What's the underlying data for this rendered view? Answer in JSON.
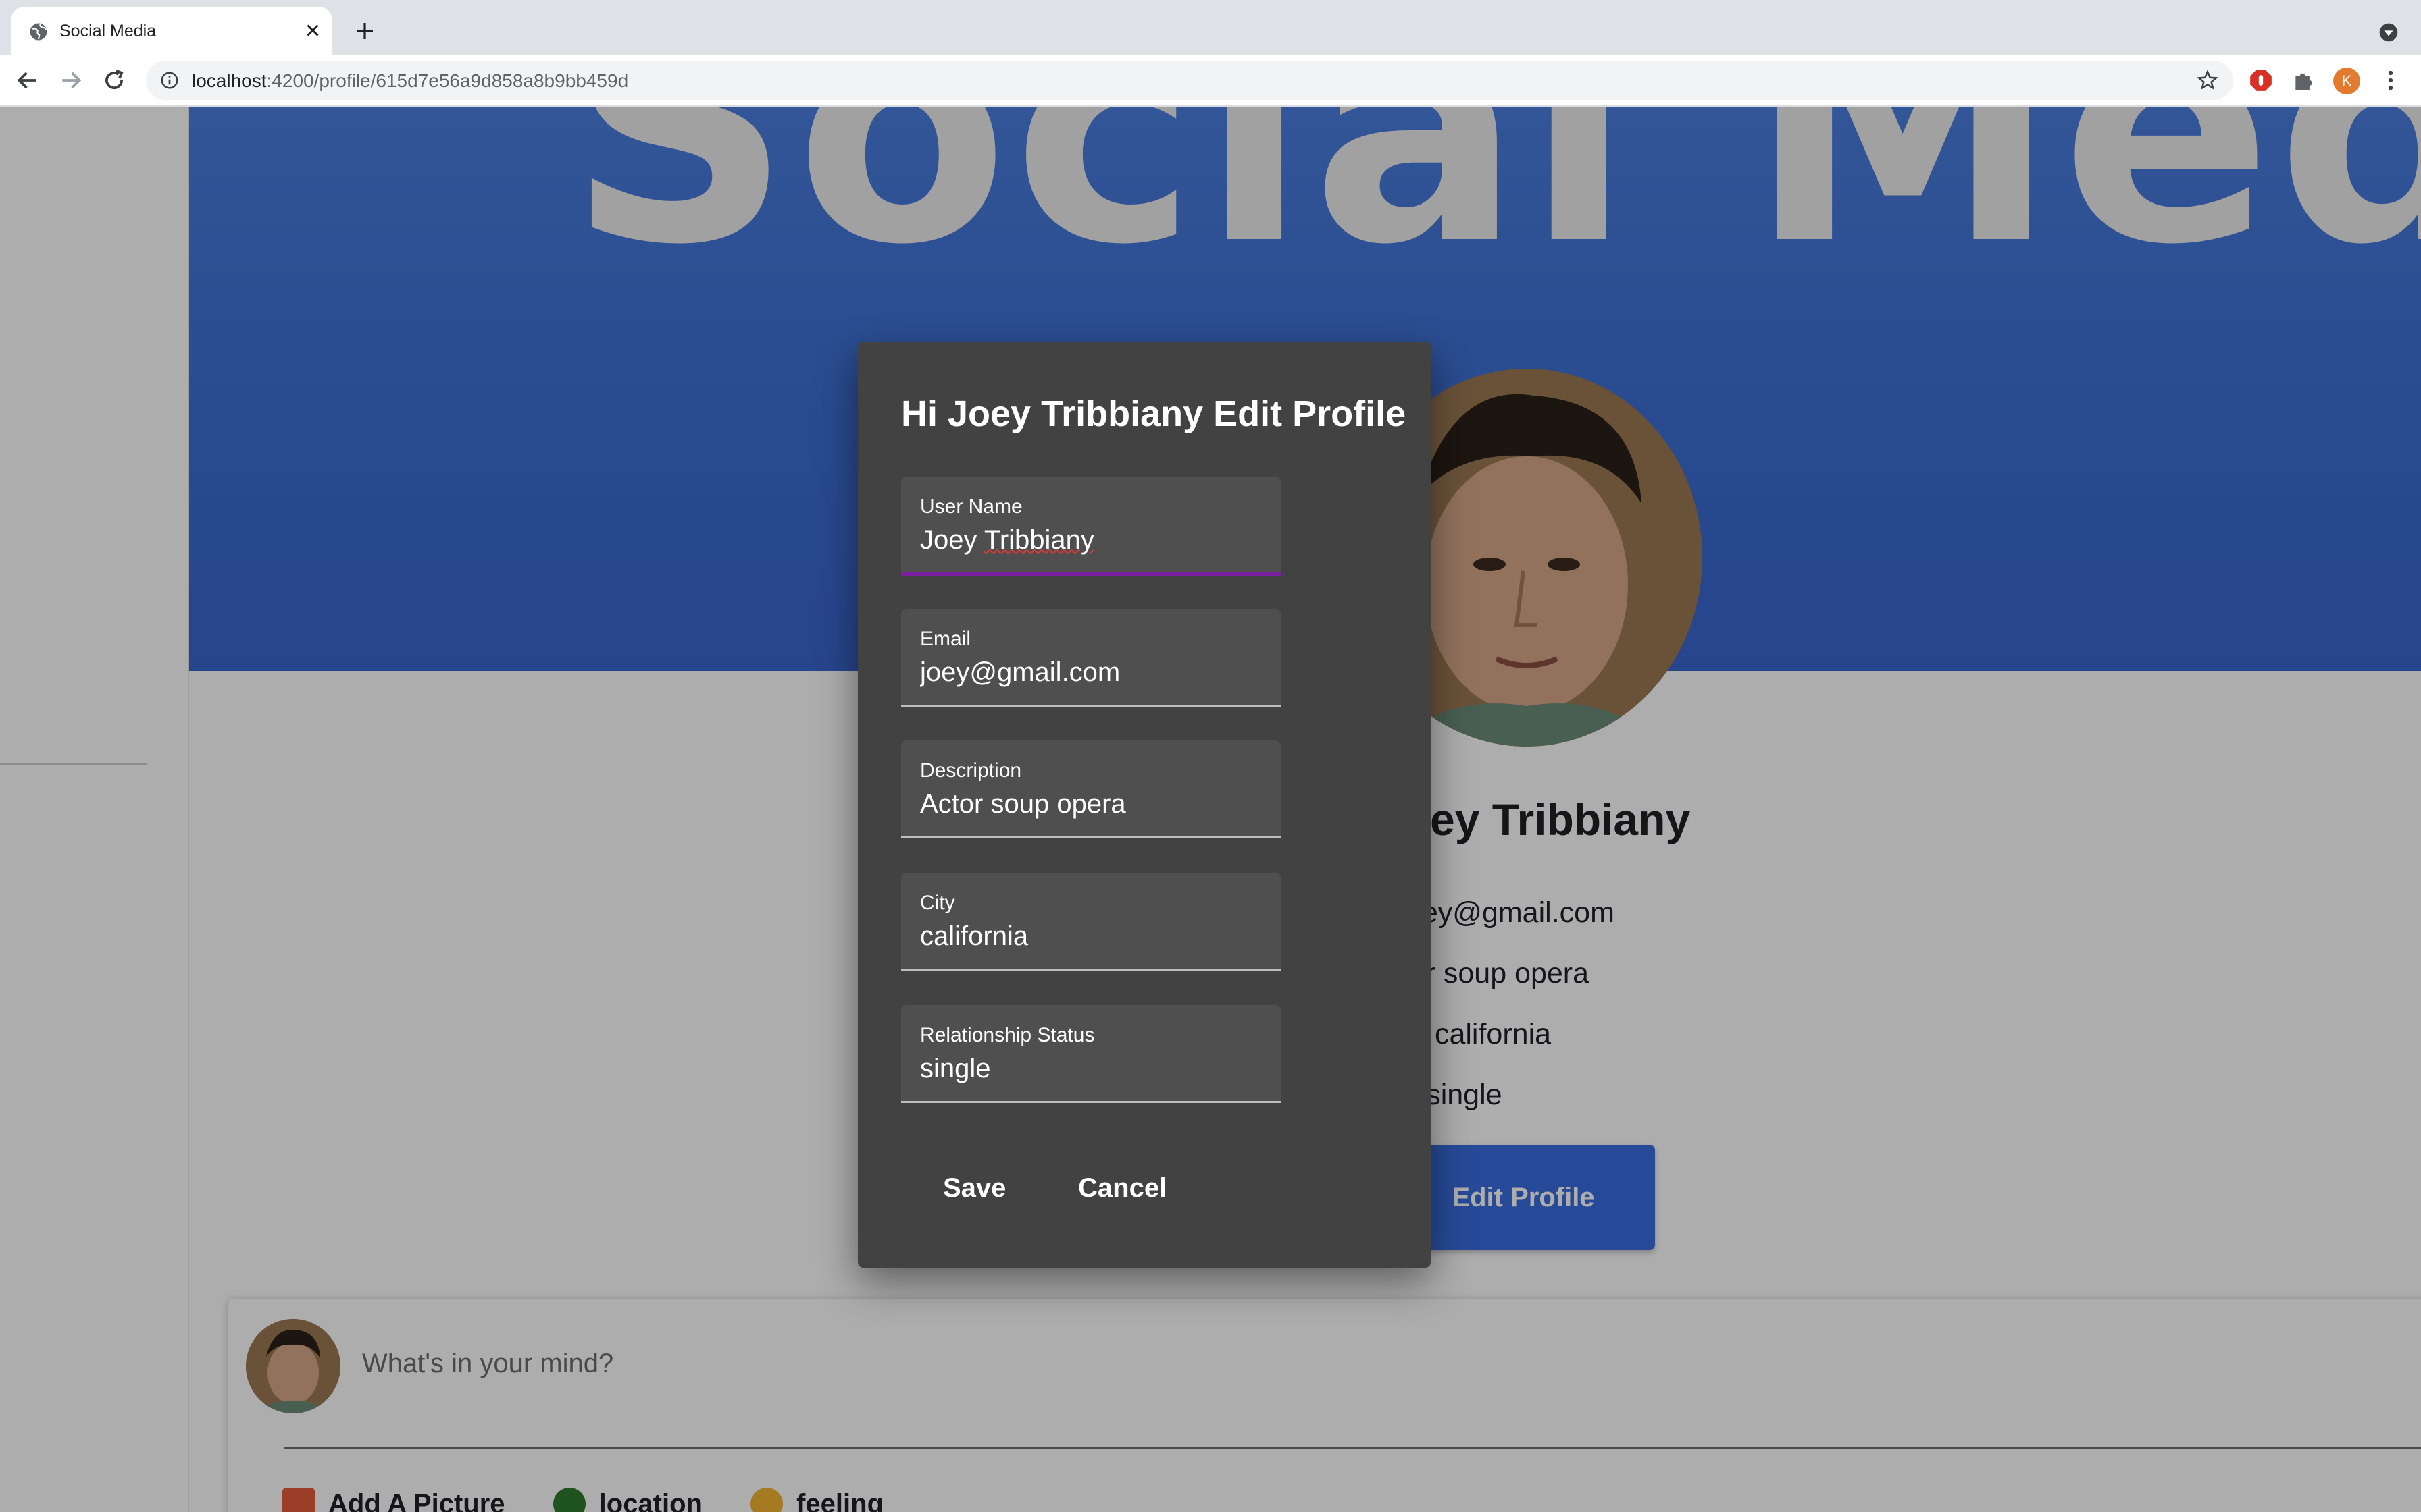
{
  "browser": {
    "tab_title": "Social Media",
    "url_host": "localhost",
    "url_path": ":4200/profile/615d7e56a9d858a8b9bb459d",
    "profile_initial": "K"
  },
  "cover": {
    "banner_text": "Social Media"
  },
  "profile": {
    "name": "Joey Tribbiany",
    "email_line": "Email :joey@gmail.com",
    "description_line": "Description : Actor soup opera",
    "city_line": "City: california",
    "relationship_line": "Relationship status: single",
    "edit_button": "Edit Profile"
  },
  "post_composer": {
    "placeholder": "What's in your mind?",
    "actions": [
      "Add A Picture",
      "location",
      "feeling"
    ]
  },
  "dialog": {
    "title": "Hi Joey Tribbiany Edit Profile",
    "fields": [
      {
        "label": "User Name",
        "value": "Joey Tribbiany"
      },
      {
        "label": "Email",
        "value": "joey@gmail.com"
      },
      {
        "label": "Description",
        "value": "Actor soup opera"
      },
      {
        "label": "City",
        "value": "california"
      },
      {
        "label": "Relationship Status",
        "value": "single"
      }
    ],
    "save": "Save",
    "cancel": "Cancel"
  },
  "colors": {
    "cover_blue": "#3a66d0",
    "dialog_bg": "#424242",
    "focus_underline": "#7b1fa2",
    "primary_button": "#3a6ee0"
  }
}
